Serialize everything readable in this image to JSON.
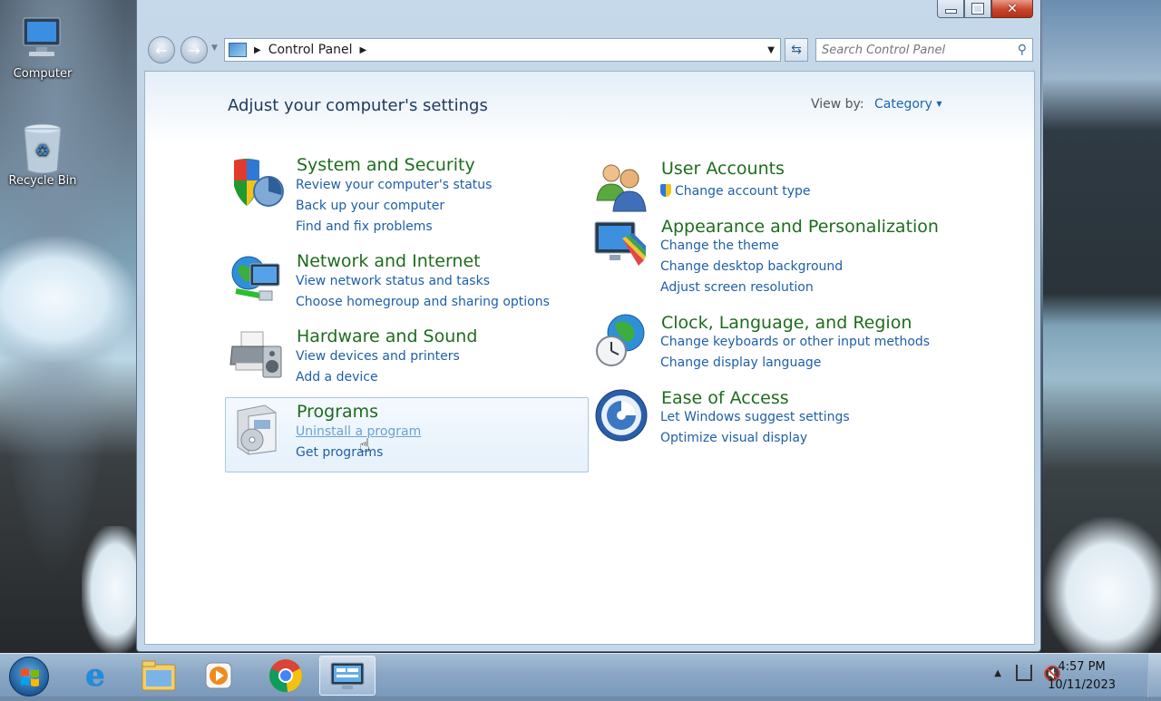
{
  "desktop": {
    "icons": [
      {
        "label": "Computer"
      },
      {
        "label": "Recycle Bin"
      }
    ]
  },
  "window": {
    "address": {
      "crumbs": [
        "Control Panel"
      ],
      "search_placeholder": "Search Control Panel"
    },
    "header": {
      "title": "Adjust your computer's settings",
      "view_by_label": "View by:",
      "view_by_value": "Category"
    },
    "categories": [
      {
        "title": "System and Security",
        "icon": "shield-icon",
        "links": [
          "Review your computer's status",
          "Back up your computer",
          "Find and fix problems"
        ]
      },
      {
        "title": "Network and Internet",
        "icon": "network-globe-icon",
        "links": [
          "View network status and tasks",
          "Choose homegroup and sharing options"
        ]
      },
      {
        "title": "Hardware and Sound",
        "icon": "printer-speaker-icon",
        "links": [
          "View devices and printers",
          "Add a device"
        ]
      },
      {
        "title": "Programs",
        "icon": "programs-box-icon",
        "links": [
          "Uninstall a program",
          "Get programs"
        ]
      },
      {
        "title": "User Accounts",
        "icon": "users-icon",
        "links": [
          "Change account type"
        ]
      },
      {
        "title": "Appearance and Personalization",
        "icon": "monitor-palette-icon",
        "links": [
          "Change the theme",
          "Change desktop background",
          "Adjust screen resolution"
        ]
      },
      {
        "title": "Clock, Language, and Region",
        "icon": "globe-clock-icon",
        "links": [
          "Change keyboards or other input methods",
          "Change display language"
        ]
      },
      {
        "title": "Ease of Access",
        "icon": "ease-of-access-icon",
        "links": [
          "Let Windows suggest settings",
          "Optimize visual display"
        ]
      }
    ]
  },
  "taskbar": {
    "time": "4:57 PM",
    "date": "10/11/2023",
    "pinned": [
      "internet-explorer-icon",
      "file-explorer-icon",
      "media-player-icon",
      "chrome-icon",
      "control-panel-icon"
    ]
  },
  "colors": {
    "category_title": "#1e6c1e",
    "link": "#1f5fa8",
    "link_hover": "#6aa2d4"
  }
}
